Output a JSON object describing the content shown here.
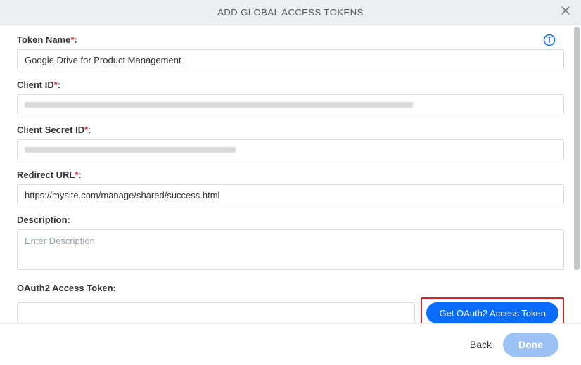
{
  "header": {
    "title": "ADD GLOBAL ACCESS TOKENS"
  },
  "form": {
    "tokenName": {
      "label": "Token Name",
      "value": "Google Drive for Product Management"
    },
    "clientId": {
      "label": "Client ID",
      "value": ""
    },
    "clientSecret": {
      "label": "Client Secret ID",
      "value": ""
    },
    "redirectUrl": {
      "label": "Redirect URL",
      "value": "https://mysite.com/manage/shared/success.html"
    },
    "description": {
      "label": "Description",
      "placeholder": "Enter Description",
      "value": ""
    },
    "oauthToken": {
      "label": "OAuth2 Access Token",
      "value": "",
      "buttonLabel": "Get OAuth2 Access Token"
    }
  },
  "footer": {
    "back": "Back",
    "done": "Done"
  }
}
